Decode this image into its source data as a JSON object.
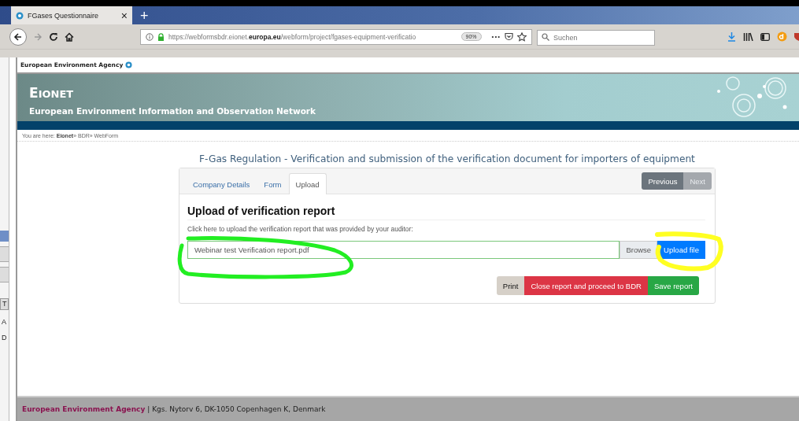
{
  "browser": {
    "tab": {
      "title": "FGases Questionnaire",
      "close": "×"
    },
    "new_tab": "+",
    "url": {
      "prefix": "https://webformsbdr.eionet.",
      "domain": "europa.eu",
      "path": "/webform/project/fgases-equipment-verificatio"
    },
    "zoom": "90%",
    "more": "•••",
    "search": {
      "placeholder": "Suchen"
    }
  },
  "side_window": {
    "letters": [
      "T",
      "A",
      "D"
    ]
  },
  "site": {
    "agency": "European Environment Agency",
    "brand": "EIONET",
    "subtitle": "European Environment Information and Observation Network",
    "breadcrumb": "You are here: **Eionet**» BDR» WebForm"
  },
  "page_title": "F-Gas Regulation - Verification and submission of the verification document for importers of equipment",
  "tabs": [
    {
      "label": "Company Details",
      "selected": false
    },
    {
      "label": "Form",
      "selected": false
    },
    {
      "label": "Upload",
      "selected": true
    }
  ],
  "pager": [
    {
      "label": "Previous",
      "disabled": false
    },
    {
      "label": "Next",
      "disabled": true
    }
  ],
  "section": {
    "heading": "Upload of verification report",
    "instruction": "Click here to upload the verification report that was provided by your auditor:",
    "file": {
      "value": "Webinar test Verification report.pdf"
    },
    "browse": "Browse",
    "upload": "Upload file"
  },
  "actions": [
    {
      "label": "Print",
      "kind": "print"
    },
    {
      "label": "Close report and proceed to BDR",
      "kind": "close"
    },
    {
      "label": "Save report",
      "kind": "save"
    }
  ],
  "footer": {
    "agency": "European Environment Agency",
    "address": "| Kgs. Nytorv 6, DK-1050 Copenhagen K, Denmark"
  },
  "annotations": [
    {
      "kind": "file-field",
      "color": "#22ee22"
    },
    {
      "kind": "upload-button",
      "color": "#ffff22"
    }
  ]
}
